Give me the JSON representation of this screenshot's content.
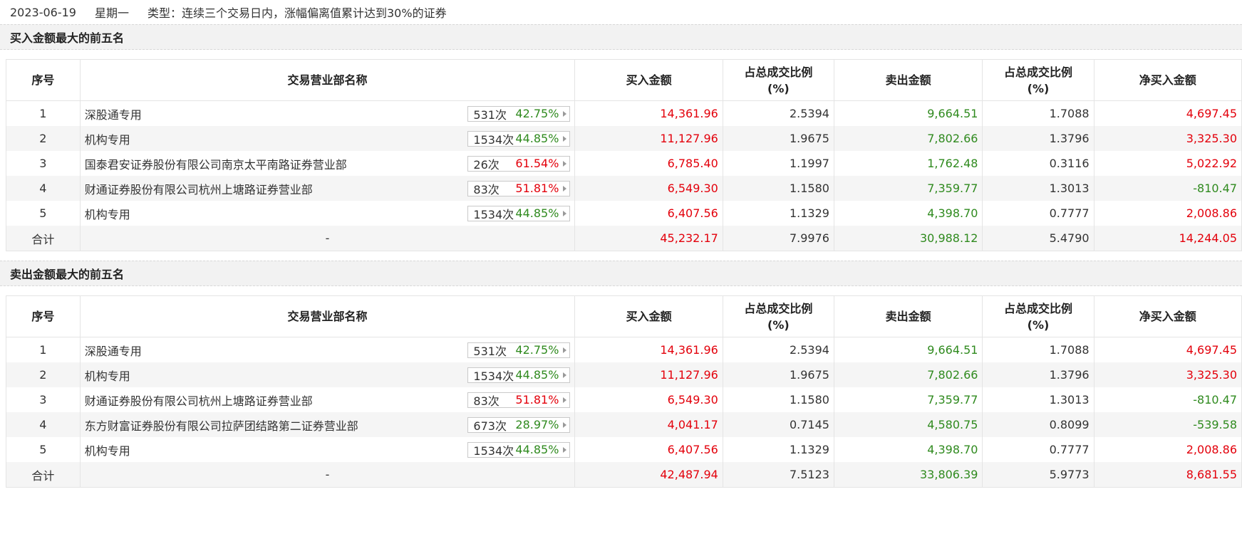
{
  "header": {
    "date": "2023-06-19",
    "weekday": "星期一",
    "type_text": "类型：连续三个交易日内，涨幅偏离值累计达到30%的证券"
  },
  "columns": [
    "序号",
    "交易营业部名称",
    "买入金额",
    "占总成交比例(%)",
    "卖出金额",
    "占总成交比例(%)",
    "净买入金额"
  ],
  "colors": {
    "positive": "#e3000b",
    "negative": "#2f8a1e"
  },
  "buy_top5": {
    "title": "买入金额最大的前五名",
    "rows": [
      {
        "idx": "1",
        "name": "深股通专用",
        "times": "531次",
        "rate": "42.75%",
        "rate_color": "green",
        "buy": "14,361.96",
        "buy_pct": "2.5394",
        "sell": "9,664.51",
        "sell_pct": "1.7088",
        "net": "4,697.45",
        "net_color": "red"
      },
      {
        "idx": "2",
        "name": "机构专用",
        "times": "1534次",
        "rate": "44.85%",
        "rate_color": "green",
        "buy": "11,127.96",
        "buy_pct": "1.9675",
        "sell": "7,802.66",
        "sell_pct": "1.3796",
        "net": "3,325.30",
        "net_color": "red"
      },
      {
        "idx": "3",
        "name": "国泰君安证券股份有限公司南京太平南路证券营业部",
        "times": "26次",
        "rate": "61.54%",
        "rate_color": "red",
        "buy": "6,785.40",
        "buy_pct": "1.1997",
        "sell": "1,762.48",
        "sell_pct": "0.3116",
        "net": "5,022.92",
        "net_color": "red"
      },
      {
        "idx": "4",
        "name": "财通证券股份有限公司杭州上塘路证券营业部",
        "times": "83次",
        "rate": "51.81%",
        "rate_color": "red",
        "buy": "6,549.30",
        "buy_pct": "1.1580",
        "sell": "7,359.77",
        "sell_pct": "1.3013",
        "net": "-810.47",
        "net_color": "green"
      },
      {
        "idx": "5",
        "name": "机构专用",
        "times": "1534次",
        "rate": "44.85%",
        "rate_color": "green",
        "buy": "6,407.56",
        "buy_pct": "1.1329",
        "sell": "4,398.70",
        "sell_pct": "0.7777",
        "net": "2,008.86",
        "net_color": "red"
      }
    ],
    "total": {
      "label": "合计",
      "name": "-",
      "buy": "45,232.17",
      "buy_pct": "7.9976",
      "sell": "30,988.12",
      "sell_pct": "5.4790",
      "net": "14,244.05",
      "net_color": "red"
    }
  },
  "sell_top5": {
    "title": "卖出金额最大的前五名",
    "rows": [
      {
        "idx": "1",
        "name": "深股通专用",
        "times": "531次",
        "rate": "42.75%",
        "rate_color": "green",
        "buy": "14,361.96",
        "buy_pct": "2.5394",
        "sell": "9,664.51",
        "sell_pct": "1.7088",
        "net": "4,697.45",
        "net_color": "red"
      },
      {
        "idx": "2",
        "name": "机构专用",
        "times": "1534次",
        "rate": "44.85%",
        "rate_color": "green",
        "buy": "11,127.96",
        "buy_pct": "1.9675",
        "sell": "7,802.66",
        "sell_pct": "1.3796",
        "net": "3,325.30",
        "net_color": "red"
      },
      {
        "idx": "3",
        "name": "财通证券股份有限公司杭州上塘路证券营业部",
        "times": "83次",
        "rate": "51.81%",
        "rate_color": "red",
        "buy": "6,549.30",
        "buy_pct": "1.1580",
        "sell": "7,359.77",
        "sell_pct": "1.3013",
        "net": "-810.47",
        "net_color": "green"
      },
      {
        "idx": "4",
        "name": "东方财富证券股份有限公司拉萨团结路第二证券营业部",
        "times": "673次",
        "rate": "28.97%",
        "rate_color": "green",
        "buy": "4,041.17",
        "buy_pct": "0.7145",
        "sell": "4,580.75",
        "sell_pct": "0.8099",
        "net": "-539.58",
        "net_color": "green"
      },
      {
        "idx": "5",
        "name": "机构专用",
        "times": "1534次",
        "rate": "44.85%",
        "rate_color": "green",
        "buy": "6,407.56",
        "buy_pct": "1.1329",
        "sell": "4,398.70",
        "sell_pct": "0.7777",
        "net": "2,008.86",
        "net_color": "red"
      }
    ],
    "total": {
      "label": "合计",
      "name": "-",
      "buy": "42,487.94",
      "buy_pct": "7.5123",
      "sell": "33,806.39",
      "sell_pct": "5.9773",
      "net": "8,681.55",
      "net_color": "red"
    }
  }
}
